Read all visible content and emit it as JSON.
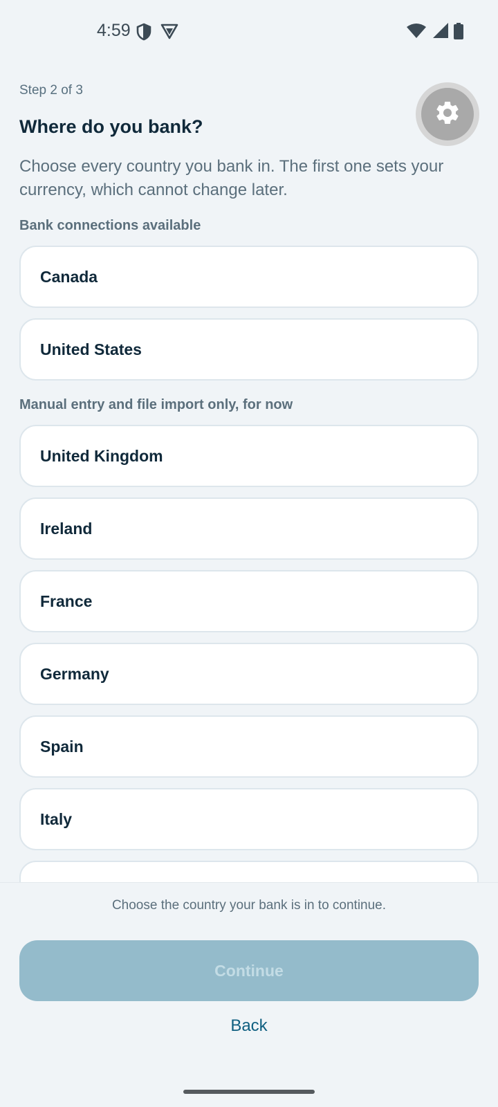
{
  "status_bar": {
    "time": "4:59",
    "left_icons": [
      "shield-icon",
      "vpn-icon"
    ],
    "right_icons": [
      "wifi-icon",
      "cellular-icon",
      "battery-icon"
    ]
  },
  "header": {
    "step": "Step 2 of 3",
    "title": "Where do you bank?",
    "description": "Choose every country you bank in. The first one sets your currency, which cannot change later.",
    "settings_icon": "gear-icon"
  },
  "sections": [
    {
      "label": "Bank connections available",
      "countries": [
        "Canada",
        "United States"
      ]
    },
    {
      "label": "Manual entry and file import only, for now",
      "countries": [
        "United Kingdom",
        "Ireland",
        "France",
        "Germany",
        "Spain",
        "Italy"
      ]
    }
  ],
  "footer": {
    "hint": "Choose the country your bank is in to continue.",
    "continue_label": "Continue",
    "continue_disabled": true,
    "back_label": "Back"
  },
  "colors": {
    "background": "#f0f4f7",
    "primary_disabled": "#94bbcb",
    "link": "#0f5f80",
    "title": "#10293a"
  }
}
